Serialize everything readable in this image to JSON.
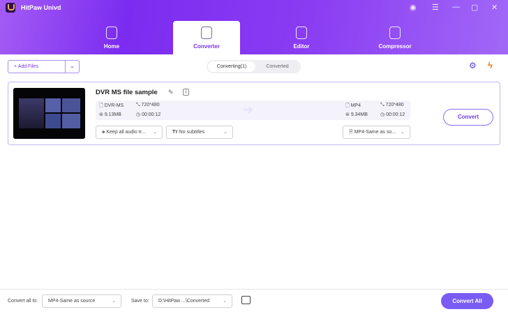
{
  "app": {
    "title": "HitPaw Univd"
  },
  "nav": {
    "tabs": [
      {
        "label": "Home"
      },
      {
        "label": "Converter",
        "active": true
      },
      {
        "label": "Editor"
      },
      {
        "label": "Compressor"
      }
    ]
  },
  "toolbar": {
    "add_files": "+ Add Files",
    "segments": [
      "Converting(1)",
      "Converted"
    ],
    "hw_accel_icon": "gpu-on-icon",
    "speed_icon": "lightning-on-icon"
  },
  "file": {
    "name": "DVR MS file sample",
    "source": {
      "format": "DVR-MS",
      "resolution": "720*480",
      "size": "9.13MB",
      "duration": "00:00:12"
    },
    "output": {
      "format": "MP4",
      "resolution": "720*480",
      "size": "9.34MB",
      "duration": "00:00:12"
    },
    "audio": "Keep all audio tr...",
    "subtitles": "No subtitles",
    "output_format": "MP4-Same as so...",
    "convert": "Convert"
  },
  "footer": {
    "convert_all_label": "Convert all to:",
    "convert_all_value": "MP4-Same as source",
    "save_to_label": "Save to:",
    "save_to_value": "D:\\HitPaw ...\\Converted",
    "convert_all_button": "Convert All"
  },
  "colors": {
    "accent": "#7a5cf5",
    "header": "#7b2cf0"
  }
}
